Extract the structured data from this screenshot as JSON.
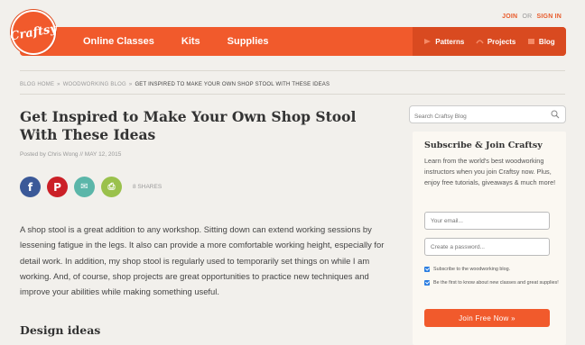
{
  "header": {
    "logo_text": "Craftsy",
    "join_label": "JOIN",
    "or_label": "OR",
    "signin_label": "SIGN IN",
    "nav_left": [
      "Online Classes",
      "Kits",
      "Supplies"
    ],
    "nav_right": [
      {
        "label": "Patterns",
        "icon": "patterns-icon"
      },
      {
        "label": "Projects",
        "icon": "projects-icon"
      },
      {
        "label": "Blog",
        "icon": "blog-icon"
      }
    ],
    "accent": "#f15a2c"
  },
  "breadcrumb": {
    "items": [
      "BLOG HOME",
      "WOODWORKING BLOG"
    ],
    "separator": "»",
    "current": "GET INSPIRED TO MAKE YOUR OWN SHOP STOOL WITH THESE IDEAS"
  },
  "article": {
    "title": "Get Inspired to Make Your Own Shop Stool With These Ideas",
    "byline": "Posted by Chris Wong // MAY 12, 2015",
    "shares": "8 SHARES",
    "body": "A shop stool is a great addition to any workshop. Sitting down can extend working sessions by lessening fatigue in the legs. It also can provide a more comfortable working height, especially for detail work. In addition, my shop stool is regularly used to temporarily set things on while I am working. And, of course, shop projects are great opportunities to practice new techniques and improve your abilities while making something useful.",
    "subheading": "Design ideas"
  },
  "sidebar": {
    "search_placeholder": "Search Craftsy Blog",
    "card_title": "Subscribe & Join Craftsy",
    "card_desc": "Learn from the world's best woodworking instructors when you join Craftsy now. Plus, enjoy free tutorials, giveaways & much more!",
    "email_placeholder": "Your email...",
    "password_placeholder": "Create a password...",
    "checkbox1": "Subscribe to the woodworking blog.",
    "checkbox2": "Be the first to know about new classes and great supplies!",
    "join_button": "Join Free Now »"
  },
  "social": {
    "facebook": "f",
    "pinterest": "P",
    "email": "✉",
    "print": "⎙"
  }
}
